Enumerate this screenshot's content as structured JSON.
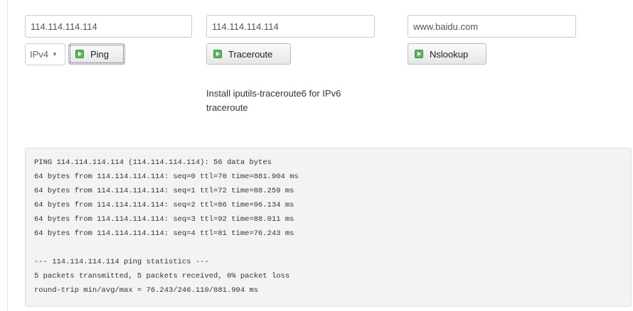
{
  "ping": {
    "host_value": "114.114.114.114",
    "ip_version": "IPv4",
    "button_label": "Ping"
  },
  "traceroute": {
    "host_value": "114.114.114.114",
    "button_label": "Traceroute",
    "note": "Install iputils-traceroute6 for IPv6 traceroute"
  },
  "nslookup": {
    "host_value": "www.baidu.com",
    "button_label": "Nslookup"
  },
  "output": {
    "text": "PING 114.114.114.114 (114.114.114.114): 56 data bytes\n64 bytes from 114.114.114.114: seq=0 ttl=70 time=881.904 ms\n64 bytes from 114.114.114.114: seq=1 ttl=72 time=88.259 ms\n64 bytes from 114.114.114.114: seq=2 ttl=86 time=96.134 ms\n64 bytes from 114.114.114.114: seq=3 ttl=92 time=88.011 ms\n64 bytes from 114.114.114.114: seq=4 ttl=81 time=76.243 ms\n\n--- 114.114.114.114 ping statistics ---\n5 packets transmitted, 5 packets received, 0% packet loss\nround-trip min/avg/max = 76.243/246.110/881.904 ms"
  }
}
